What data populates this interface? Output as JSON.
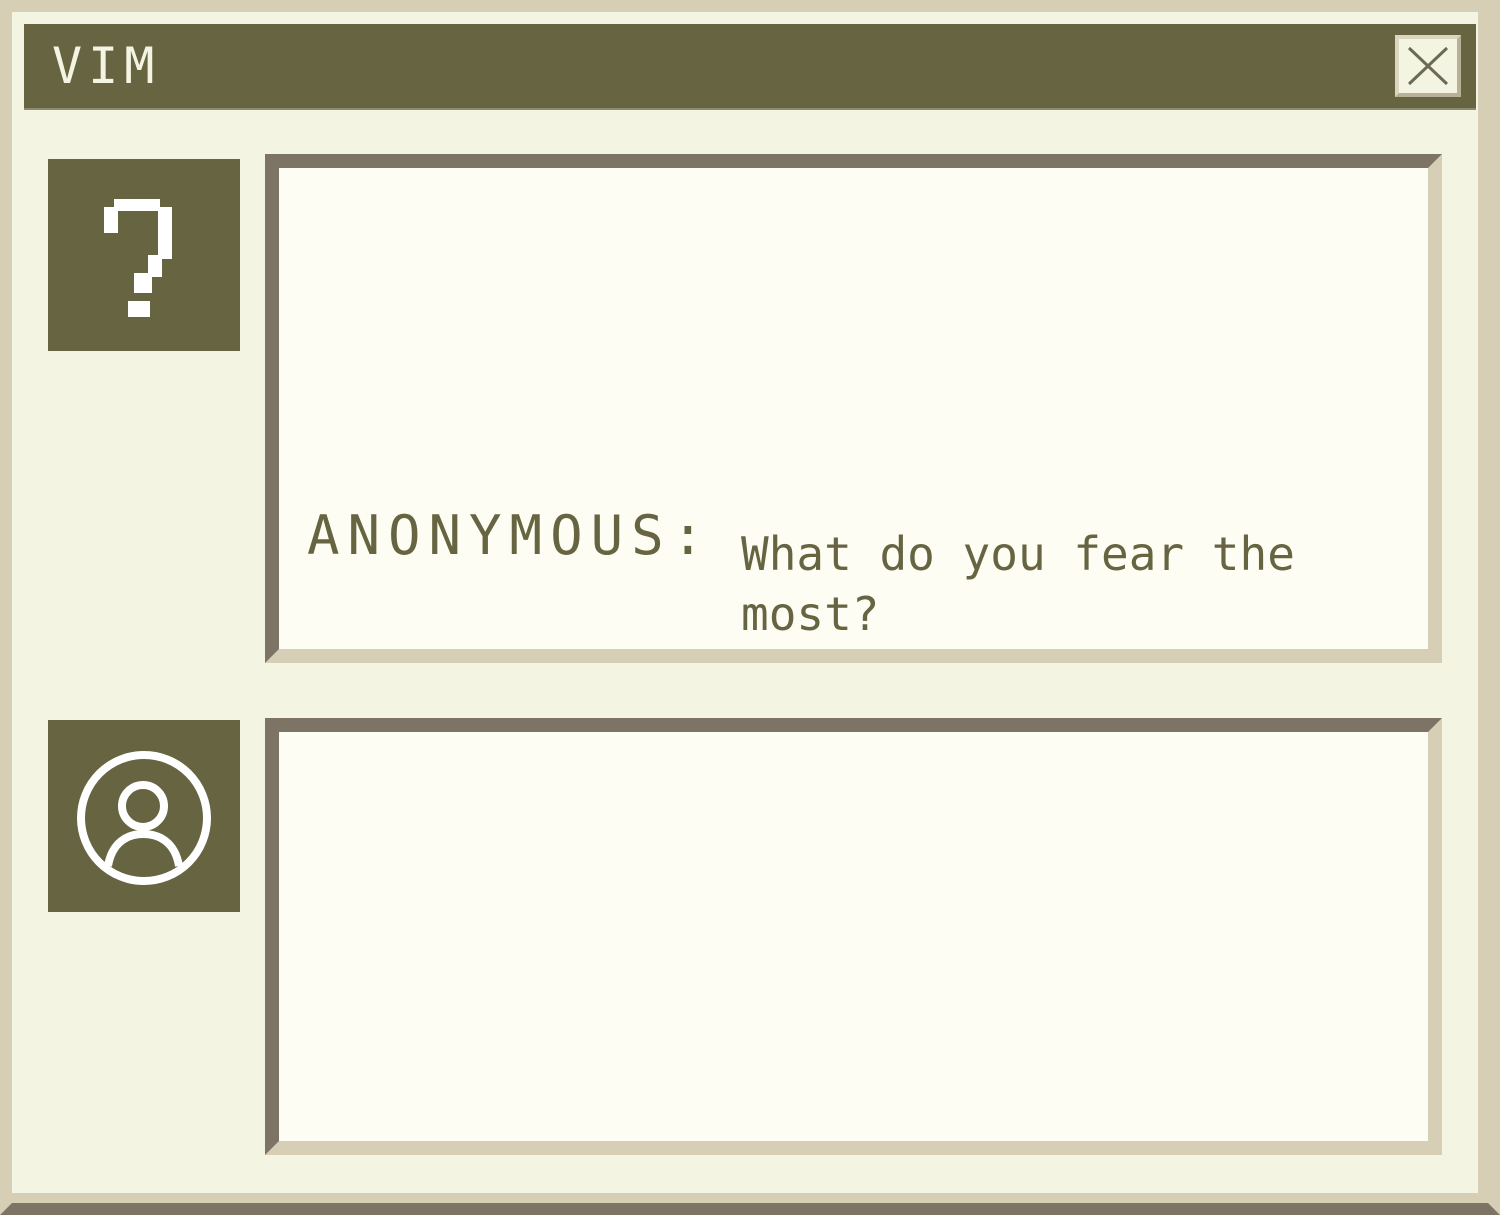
{
  "window": {
    "title": "VIM",
    "close_icon": "close-icon"
  },
  "chat": {
    "question_icon": "question-icon",
    "user_icon": "user-avatar-icon",
    "message": {
      "sender": "ANONYMOUS:",
      "text": "What do you fear the most?"
    },
    "reply": {
      "value": ""
    }
  },
  "colors": {
    "window_bg": "#f4f4e2",
    "accent": "#666441",
    "panel_bg": "#fdfdf3",
    "bevel_dark": "#7d7466",
    "bevel_light": "#d6cfb6"
  }
}
